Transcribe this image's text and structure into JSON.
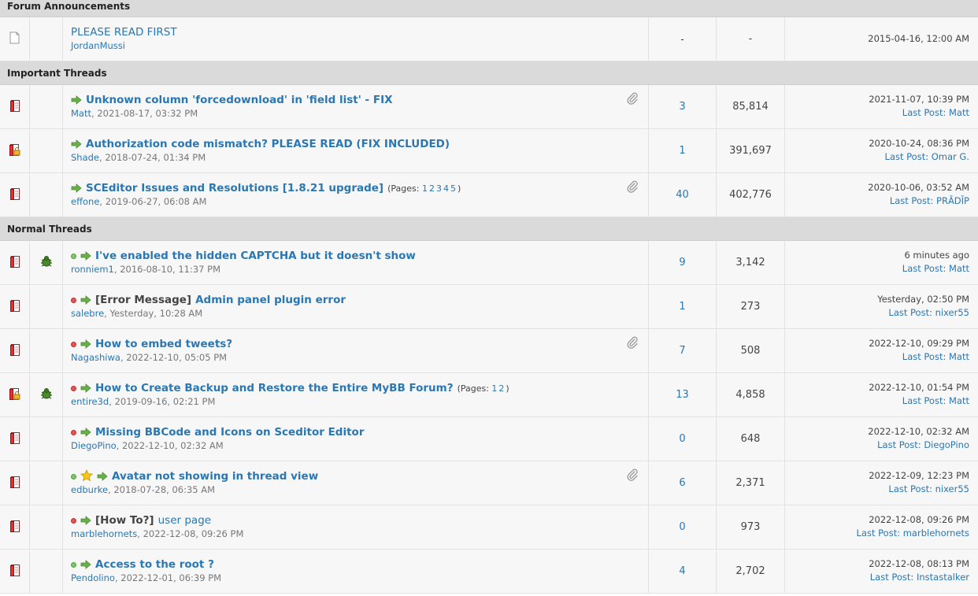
{
  "sections": [
    {
      "header": "Forum Announcements",
      "rows": [
        {
          "type": "announcement",
          "title": "PLEASE READ FIRST",
          "author": "JordanMussi",
          "replies": "-",
          "views": "-",
          "last_date": "2015-04-16, 12:00 AM"
        }
      ]
    },
    {
      "header": "Important Threads",
      "rows": [
        {
          "title": "Unknown column 'forcedownload' in 'field list' - FIX",
          "author": "Matt",
          "date": "2021-08-17, 03:32 PM",
          "replies": "3",
          "views": "85,814",
          "last_date": "2021-11-07, 10:39 PM",
          "last_prefix": "Last Post:",
          "last_user": "Matt",
          "attachment": true,
          "locked": false
        },
        {
          "title": "Authorization code mismatch? PLEASE READ (FIX INCLUDED)",
          "author": "Shade",
          "date": "2018-07-24, 01:34 PM",
          "replies": "1",
          "views": "391,697",
          "last_date": "2020-10-24, 08:36 PM",
          "last_prefix": "Last Post:",
          "last_user": "Omar G.",
          "attachment": false,
          "locked": true
        },
        {
          "title": "SCEditor Issues and Resolutions [1.8.21 upgrade]",
          "pages_label": "(Pages:",
          "pages": [
            "1",
            "2",
            "3",
            "4",
            "5"
          ],
          "pages_end": ")",
          "author": "effone",
          "date": "2019-06-27, 06:08 AM",
          "replies": "40",
          "views": "402,776",
          "last_date": "2020-10-06, 03:52 AM",
          "last_prefix": "Last Post:",
          "last_user": "PRĀDĪP",
          "attachment": true,
          "locked": false
        }
      ]
    },
    {
      "header": "Normal Threads",
      "rows": [
        {
          "dot": "green",
          "bug": true,
          "title": "I've enabled the hidden CAPTCHA but it doesn't show",
          "author": "ronniem1",
          "date": "2016-08-10, 11:37 PM",
          "replies": "9",
          "views": "3,142",
          "last_date": "6 minutes ago",
          "last_prefix": "Last Post:",
          "last_user": "Matt"
        },
        {
          "dot": "red",
          "prefix": "[Error Message]",
          "title": "Admin panel plugin error",
          "author": "salebre",
          "date": "Yesterday, 10:28 AM",
          "replies": "1",
          "views": "273",
          "last_date": "Yesterday, 02:50 PM",
          "last_prefix": "Last Post:",
          "last_user": "nixer55"
        },
        {
          "dot": "red",
          "title": "How to embed tweets?",
          "author": "Nagashiwa",
          "date": "2022-12-10, 05:05 PM",
          "replies": "7",
          "views": "508",
          "last_date": "2022-12-10, 09:29 PM",
          "last_prefix": "Last Post:",
          "last_user": "Matt",
          "attachment": true
        },
        {
          "dot": "red",
          "bug": true,
          "locked": true,
          "title": "How to Create Backup and Restore the Entire MyBB Forum?",
          "pages_label": "(Pages:",
          "pages": [
            "1",
            "2"
          ],
          "pages_end": ")",
          "author": "entire3d",
          "date": "2019-09-16, 02:21 PM",
          "replies": "13",
          "views": "4,858",
          "last_date": "2022-12-10, 01:54 PM",
          "last_prefix": "Last Post:",
          "last_user": "Matt"
        },
        {
          "dot": "red",
          "title": "Missing BBCode and Icons on Sceditor Editor",
          "author": "DiegoPino",
          "date": "2022-12-10, 02:32 AM",
          "replies": "0",
          "views": "648",
          "last_date": "2022-12-10, 02:32 AM",
          "last_prefix": "Last Post:",
          "last_user": "DiegoPino"
        },
        {
          "dot": "green",
          "star": true,
          "title": "Avatar not showing in thread view",
          "author": "edburke",
          "date": "2018-07-28, 06:35 AM",
          "replies": "6",
          "views": "2,371",
          "last_date": "2022-12-09, 12:23 PM",
          "last_prefix": "Last Post:",
          "last_user": "nixer55",
          "attachment": true
        },
        {
          "dot": "red",
          "prefix": "[How To?]",
          "title": "user page",
          "plain": true,
          "author": "marblehornets",
          "date": "2022-12-08, 09:26 PM",
          "replies": "0",
          "views": "973",
          "last_date": "2022-12-08, 09:26 PM",
          "last_prefix": "Last Post:",
          "last_user": "marblehornets"
        },
        {
          "dot": "green",
          "title": "Access to the root ?",
          "author": "Pendolino",
          "date": "2022-12-01, 06:39 PM",
          "replies": "4",
          "views": "2,702",
          "last_date": "2022-12-08, 08:13 PM",
          "last_prefix": "Last Post:",
          "last_user": "Instastalker"
        }
      ]
    }
  ],
  "icons": {
    "thread_status": "folder-doc-icon",
    "locked": "lock-icon",
    "bug": "bug-icon",
    "star": "star-icon",
    "arrow": "right-arrow-icon",
    "attachment": "paperclip-icon"
  },
  "colors": {
    "link": "#2a77b3",
    "header_bg": "#dadada",
    "row_bg": "#f7f7f7"
  }
}
